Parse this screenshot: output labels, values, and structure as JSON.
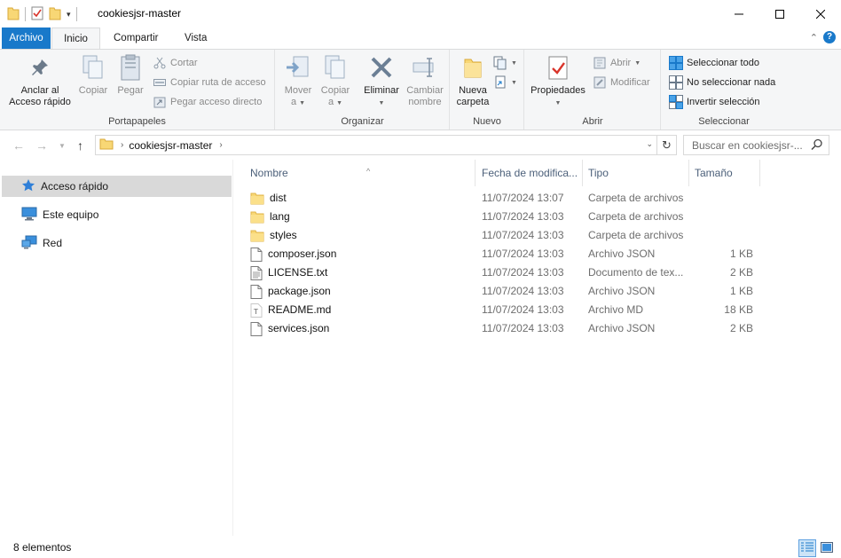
{
  "window": {
    "title": "cookiesjsr-master"
  },
  "ribbon_tabs": {
    "file": "Archivo",
    "home": "Inicio",
    "share": "Compartir",
    "view": "Vista"
  },
  "ribbon": {
    "clipboard": {
      "label": "Portapapeles",
      "pin_line1": "Anclar al",
      "pin_line2": "Acceso rápido",
      "copy": "Copiar",
      "paste": "Pegar",
      "cut": "Cortar",
      "copy_path": "Copiar ruta de acceso",
      "paste_shortcut": "Pegar acceso directo"
    },
    "organize": {
      "label": "Organizar",
      "move_line1": "Mover",
      "move_line2": "a",
      "copy_line1": "Copiar",
      "copy_line2": "a",
      "delete": "Eliminar",
      "rename_line1": "Cambiar",
      "rename_line2": "nombre"
    },
    "new": {
      "label": "Nuevo",
      "folder_line1": "Nueva",
      "folder_line2": "carpeta"
    },
    "open": {
      "label": "Abrir",
      "properties": "Propiedades",
      "open": "Abrir",
      "edit": "Modificar"
    },
    "select": {
      "label": "Seleccionar",
      "select_all": "Seleccionar todo",
      "select_none": "No seleccionar nada",
      "invert": "Invertir selección"
    }
  },
  "address": {
    "crumb": "cookiesjsr-master",
    "search_placeholder": "Buscar en cookiesjsr-..."
  },
  "navpane": {
    "items": [
      {
        "label": "Acceso rápido"
      },
      {
        "label": "Este equipo"
      },
      {
        "label": "Red"
      }
    ]
  },
  "columns": {
    "name": "Nombre",
    "date": "Fecha de modifica...",
    "type": "Tipo",
    "size": "Tamaño"
  },
  "files": [
    {
      "name": "dist",
      "date": "11/07/2024 13:07",
      "type": "Carpeta de archivos",
      "size": "",
      "icon": "folder-icon"
    },
    {
      "name": "lang",
      "date": "11/07/2024 13:03",
      "type": "Carpeta de archivos",
      "size": "",
      "icon": "folder-icon"
    },
    {
      "name": "styles",
      "date": "11/07/2024 13:03",
      "type": "Carpeta de archivos",
      "size": "",
      "icon": "folder-icon"
    },
    {
      "name": "composer.json",
      "date": "11/07/2024 13:03",
      "type": "Archivo JSON",
      "size": "1 KB",
      "icon": "file-icon"
    },
    {
      "name": "LICENSE.txt",
      "date": "11/07/2024 13:03",
      "type": "Documento de tex...",
      "size": "2 KB",
      "icon": "text-file-icon"
    },
    {
      "name": "package.json",
      "date": "11/07/2024 13:03",
      "type": "Archivo JSON",
      "size": "1 KB",
      "icon": "file-icon"
    },
    {
      "name": "README.md",
      "date": "11/07/2024 13:03",
      "type": "Archivo MD",
      "size": "18 KB",
      "icon": "markdown-file-icon"
    },
    {
      "name": "services.json",
      "date": "11/07/2024 13:03",
      "type": "Archivo JSON",
      "size": "2 KB",
      "icon": "file-icon"
    }
  ],
  "status": {
    "count": "8 elementos"
  },
  "colors": {
    "accent": "#1979ca",
    "folder": "#f8d775",
    "selection": "#d9d9d9"
  }
}
